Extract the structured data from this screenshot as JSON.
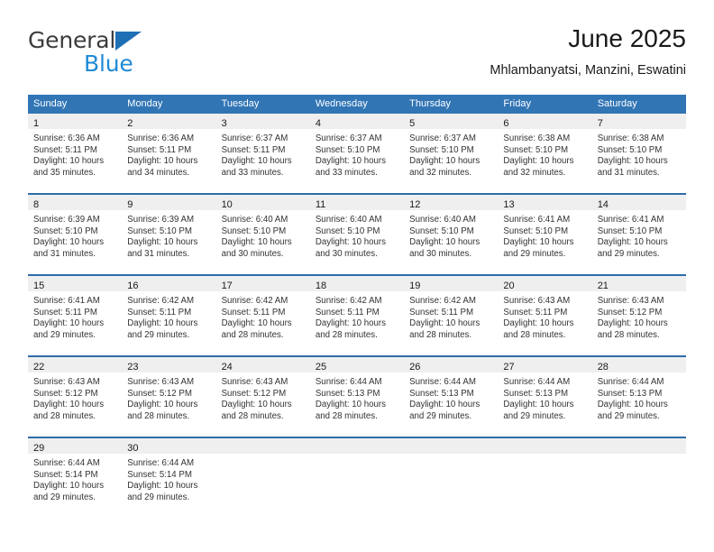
{
  "brand": {
    "name_top": "General",
    "name_bottom": "Blue",
    "accent_blue": "#1f8ad6",
    "triangle_blue": "#1f6fb5"
  },
  "header": {
    "title": "June 2025",
    "subtitle": "Mhlambanyatsi, Manzini, Eswatini"
  },
  "theme": {
    "header_bar": "#3175b5",
    "row_divider": "#2d6ca8",
    "daynum_band": "#efefef",
    "text": "#333333"
  },
  "weekdays": [
    "Sunday",
    "Monday",
    "Tuesday",
    "Wednesday",
    "Thursday",
    "Friday",
    "Saturday"
  ],
  "weeks": [
    [
      {
        "day": "1",
        "sunrise": "Sunrise: 6:36 AM",
        "sunset": "Sunset: 5:11 PM",
        "daylight1": "Daylight: 10 hours",
        "daylight2": "and 35 minutes."
      },
      {
        "day": "2",
        "sunrise": "Sunrise: 6:36 AM",
        "sunset": "Sunset: 5:11 PM",
        "daylight1": "Daylight: 10 hours",
        "daylight2": "and 34 minutes."
      },
      {
        "day": "3",
        "sunrise": "Sunrise: 6:37 AM",
        "sunset": "Sunset: 5:11 PM",
        "daylight1": "Daylight: 10 hours",
        "daylight2": "and 33 minutes."
      },
      {
        "day": "4",
        "sunrise": "Sunrise: 6:37 AM",
        "sunset": "Sunset: 5:10 PM",
        "daylight1": "Daylight: 10 hours",
        "daylight2": "and 33 minutes."
      },
      {
        "day": "5",
        "sunrise": "Sunrise: 6:37 AM",
        "sunset": "Sunset: 5:10 PM",
        "daylight1": "Daylight: 10 hours",
        "daylight2": "and 32 minutes."
      },
      {
        "day": "6",
        "sunrise": "Sunrise: 6:38 AM",
        "sunset": "Sunset: 5:10 PM",
        "daylight1": "Daylight: 10 hours",
        "daylight2": "and 32 minutes."
      },
      {
        "day": "7",
        "sunrise": "Sunrise: 6:38 AM",
        "sunset": "Sunset: 5:10 PM",
        "daylight1": "Daylight: 10 hours",
        "daylight2": "and 31 minutes."
      }
    ],
    [
      {
        "day": "8",
        "sunrise": "Sunrise: 6:39 AM",
        "sunset": "Sunset: 5:10 PM",
        "daylight1": "Daylight: 10 hours",
        "daylight2": "and 31 minutes."
      },
      {
        "day": "9",
        "sunrise": "Sunrise: 6:39 AM",
        "sunset": "Sunset: 5:10 PM",
        "daylight1": "Daylight: 10 hours",
        "daylight2": "and 31 minutes."
      },
      {
        "day": "10",
        "sunrise": "Sunrise: 6:40 AM",
        "sunset": "Sunset: 5:10 PM",
        "daylight1": "Daylight: 10 hours",
        "daylight2": "and 30 minutes."
      },
      {
        "day": "11",
        "sunrise": "Sunrise: 6:40 AM",
        "sunset": "Sunset: 5:10 PM",
        "daylight1": "Daylight: 10 hours",
        "daylight2": "and 30 minutes."
      },
      {
        "day": "12",
        "sunrise": "Sunrise: 6:40 AM",
        "sunset": "Sunset: 5:10 PM",
        "daylight1": "Daylight: 10 hours",
        "daylight2": "and 30 minutes."
      },
      {
        "day": "13",
        "sunrise": "Sunrise: 6:41 AM",
        "sunset": "Sunset: 5:10 PM",
        "daylight1": "Daylight: 10 hours",
        "daylight2": "and 29 minutes."
      },
      {
        "day": "14",
        "sunrise": "Sunrise: 6:41 AM",
        "sunset": "Sunset: 5:10 PM",
        "daylight1": "Daylight: 10 hours",
        "daylight2": "and 29 minutes."
      }
    ],
    [
      {
        "day": "15",
        "sunrise": "Sunrise: 6:41 AM",
        "sunset": "Sunset: 5:11 PM",
        "daylight1": "Daylight: 10 hours",
        "daylight2": "and 29 minutes."
      },
      {
        "day": "16",
        "sunrise": "Sunrise: 6:42 AM",
        "sunset": "Sunset: 5:11 PM",
        "daylight1": "Daylight: 10 hours",
        "daylight2": "and 29 minutes."
      },
      {
        "day": "17",
        "sunrise": "Sunrise: 6:42 AM",
        "sunset": "Sunset: 5:11 PM",
        "daylight1": "Daylight: 10 hours",
        "daylight2": "and 28 minutes."
      },
      {
        "day": "18",
        "sunrise": "Sunrise: 6:42 AM",
        "sunset": "Sunset: 5:11 PM",
        "daylight1": "Daylight: 10 hours",
        "daylight2": "and 28 minutes."
      },
      {
        "day": "19",
        "sunrise": "Sunrise: 6:42 AM",
        "sunset": "Sunset: 5:11 PM",
        "daylight1": "Daylight: 10 hours",
        "daylight2": "and 28 minutes."
      },
      {
        "day": "20",
        "sunrise": "Sunrise: 6:43 AM",
        "sunset": "Sunset: 5:11 PM",
        "daylight1": "Daylight: 10 hours",
        "daylight2": "and 28 minutes."
      },
      {
        "day": "21",
        "sunrise": "Sunrise: 6:43 AM",
        "sunset": "Sunset: 5:12 PM",
        "daylight1": "Daylight: 10 hours",
        "daylight2": "and 28 minutes."
      }
    ],
    [
      {
        "day": "22",
        "sunrise": "Sunrise: 6:43 AM",
        "sunset": "Sunset: 5:12 PM",
        "daylight1": "Daylight: 10 hours",
        "daylight2": "and 28 minutes."
      },
      {
        "day": "23",
        "sunrise": "Sunrise: 6:43 AM",
        "sunset": "Sunset: 5:12 PM",
        "daylight1": "Daylight: 10 hours",
        "daylight2": "and 28 minutes."
      },
      {
        "day": "24",
        "sunrise": "Sunrise: 6:43 AM",
        "sunset": "Sunset: 5:12 PM",
        "daylight1": "Daylight: 10 hours",
        "daylight2": "and 28 minutes."
      },
      {
        "day": "25",
        "sunrise": "Sunrise: 6:44 AM",
        "sunset": "Sunset: 5:13 PM",
        "daylight1": "Daylight: 10 hours",
        "daylight2": "and 28 minutes."
      },
      {
        "day": "26",
        "sunrise": "Sunrise: 6:44 AM",
        "sunset": "Sunset: 5:13 PM",
        "daylight1": "Daylight: 10 hours",
        "daylight2": "and 29 minutes."
      },
      {
        "day": "27",
        "sunrise": "Sunrise: 6:44 AM",
        "sunset": "Sunset: 5:13 PM",
        "daylight1": "Daylight: 10 hours",
        "daylight2": "and 29 minutes."
      },
      {
        "day": "28",
        "sunrise": "Sunrise: 6:44 AM",
        "sunset": "Sunset: 5:13 PM",
        "daylight1": "Daylight: 10 hours",
        "daylight2": "and 29 minutes."
      }
    ],
    [
      {
        "day": "29",
        "sunrise": "Sunrise: 6:44 AM",
        "sunset": "Sunset: 5:14 PM",
        "daylight1": "Daylight: 10 hours",
        "daylight2": "and 29 minutes."
      },
      {
        "day": "30",
        "sunrise": "Sunrise: 6:44 AM",
        "sunset": "Sunset: 5:14 PM",
        "daylight1": "Daylight: 10 hours",
        "daylight2": "and 29 minutes."
      },
      {
        "day": "",
        "sunrise": "",
        "sunset": "",
        "daylight1": "",
        "daylight2": ""
      },
      {
        "day": "",
        "sunrise": "",
        "sunset": "",
        "daylight1": "",
        "daylight2": ""
      },
      {
        "day": "",
        "sunrise": "",
        "sunset": "",
        "daylight1": "",
        "daylight2": ""
      },
      {
        "day": "",
        "sunrise": "",
        "sunset": "",
        "daylight1": "",
        "daylight2": ""
      },
      {
        "day": "",
        "sunrise": "",
        "sunset": "",
        "daylight1": "",
        "daylight2": ""
      }
    ]
  ]
}
